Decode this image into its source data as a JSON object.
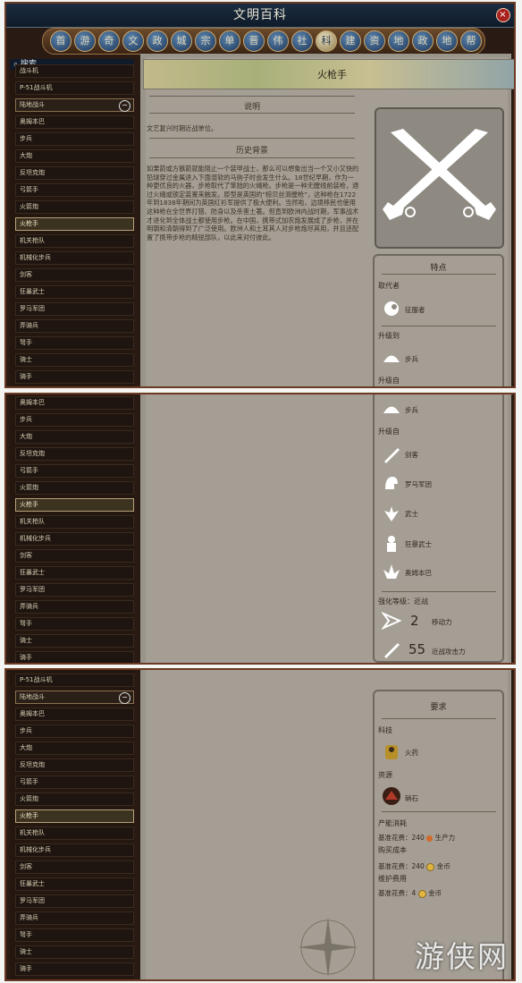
{
  "window": {
    "title": "文明百科",
    "close_glyph": "×"
  },
  "categories": [
    "首",
    "游",
    "奇",
    "文",
    "政",
    "城",
    "宗",
    "单",
    "晋",
    "伟",
    "社",
    "科",
    "建",
    "资",
    "地",
    "政",
    "地",
    "帮"
  ],
  "search": {
    "label": "搜索 ..."
  },
  "sidebar_panel1": [
    "战斗机",
    "P-51战斗机",
    "陆地战斗",
    "奥姆本巴",
    "步兵",
    "大炮",
    "反坦克炮",
    "弓箭手",
    "火箭炮",
    "火枪手",
    "机关枪队",
    "机械化步兵",
    "剑客",
    "狂暴武士",
    "罗马军团",
    "弄骑兵",
    "弩手",
    "骑士",
    "骑手"
  ],
  "sidebar_panel2": [
    "奥姆本巴",
    "步兵",
    "大炮",
    "反坦克炮",
    "弓箭手",
    "火箭炮",
    "火枪手",
    "机关枪队",
    "机械化步兵",
    "剑客",
    "狂暴武士",
    "罗马军团",
    "弄骑兵",
    "弩手",
    "骑士",
    "骑手"
  ],
  "sidebar_panel3": [
    "P-51战斗机",
    "陆地战斗",
    "奥姆本巴",
    "步兵",
    "大炮",
    "反坦克炮",
    "弓箭手",
    "火箭炮",
    "火枪手",
    "机关枪队",
    "机械化步兵",
    "剑客",
    "狂暴武士",
    "罗马军团",
    "弄骑兵",
    "弩手",
    "骑士",
    "骑手"
  ],
  "minus_glyph": "−",
  "unit": {
    "name": "火枪手",
    "description_title": "说明",
    "description": "文艺复兴时期近战单位。",
    "history_title": "历史背景",
    "history": "如果箭或方镞箭就能阻止一个装甲战士，那么可以想象出当一个又小又快的铅球穿过金属进入下面湿软的马驹子时会发生什么。18世纪早期，作为一种更优良的火器，步枪取代了笨拙的火绳枪。步枪是一种无膛线前装枪，通过火绳或锁定装置来触发。原型是英国的“棕贝丝滑膛枪”，这种枪在1722年到1838年期间为英国红衫军提供了极大便利。当然啦，边境移民也使用这种枪在全世界打猎、防身以及杀害土著。但直到欧洲内战时期，军事战术才进化到全体战士都使用步枪。在中国，携带式加农炮发展成了步枪，并在明朝和清朝得到了广泛使用。欧洲人和土耳其人对步枪炮尽其用，并且还配置了携带步枪的精锐部队，以此来对付彼此。"
  },
  "traits": {
    "title": "特点",
    "replaces_label": "取代者",
    "replaces": "征服者",
    "upgrades_to_label": "升级到",
    "upgrades_to": "步兵",
    "upgrades_from_label": "升级自",
    "upgrades_from": [
      "剑客",
      "罗马军团",
      "武士",
      "狂暴武士",
      "奥姆本巴"
    ],
    "strength_label": "强化等级：近战",
    "movement": {
      "value": "2",
      "label": "移动力"
    },
    "melee": {
      "value": "55",
      "label": "近战攻击力"
    }
  },
  "requirements": {
    "title": "要求",
    "tech_label": "科技",
    "tech": "火药",
    "resource_label": "资源",
    "resource": "硝石",
    "production_label": "产能消耗",
    "production_cost": "基准花费：240",
    "production_unit": "生产力",
    "purchase_label": "购买成本",
    "purchase_cost": "基准花费：240",
    "purchase_unit": "金币",
    "maintenance_label": "维护费用",
    "maintenance_cost": "基准花费：4",
    "maintenance_unit": "金币"
  },
  "watermark": "游侠网",
  "colors": {
    "title_bar": "#1b2d41",
    "frame": "#6b3a24",
    "parchment": "#a49e94",
    "sidebar": "#241710"
  }
}
